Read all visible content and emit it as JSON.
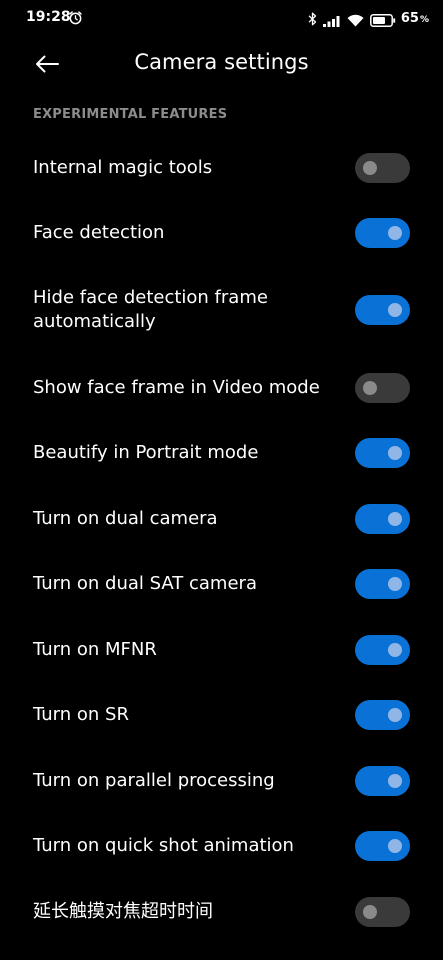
{
  "status_bar": {
    "time": "19:28",
    "battery_level": "65",
    "battery_unit": "%"
  },
  "header": {
    "title": "Camera settings"
  },
  "section": {
    "title": "EXPERIMENTAL FEATURES"
  },
  "settings": [
    {
      "label": "Internal magic tools",
      "enabled": false
    },
    {
      "label": "Face detection",
      "enabled": true
    },
    {
      "label": "Hide face detection frame automatically",
      "enabled": true
    },
    {
      "label": "Show face frame in Video mode",
      "enabled": false
    },
    {
      "label": "Beautify in Portrait mode",
      "enabled": true
    },
    {
      "label": "Turn on dual camera",
      "enabled": true
    },
    {
      "label": "Turn on dual SAT camera",
      "enabled": true
    },
    {
      "label": "Turn on MFNR",
      "enabled": true
    },
    {
      "label": "Turn on SR",
      "enabled": true
    },
    {
      "label": "Turn on parallel processing",
      "enabled": true
    },
    {
      "label": "Turn on quick shot animation",
      "enabled": true
    },
    {
      "label": "延长触摸对焦超时时间",
      "enabled": false
    }
  ],
  "colors": {
    "background": "#000000",
    "toggle_on": "#0a72d6",
    "toggle_off": "#3a3a3a",
    "section_text": "#8c8c8c"
  }
}
